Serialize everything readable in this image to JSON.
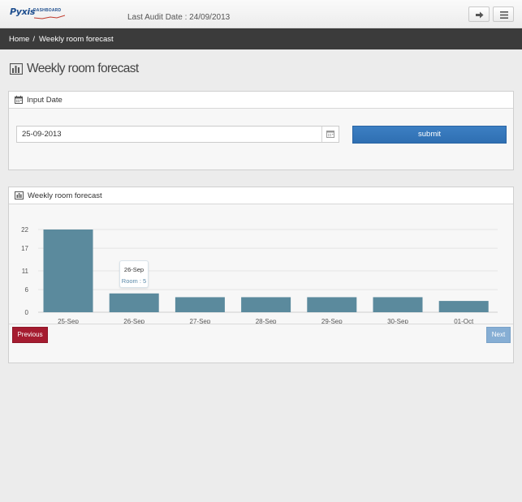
{
  "header": {
    "logo_text": "Pyxis",
    "logo_sub": "DASHBOARD",
    "audit_text": "Last Audit Date : 24/09/2013",
    "logout_icon": "sign-out-icon",
    "menu_icon": "bars-icon"
  },
  "breadcrumb": {
    "home": "Home",
    "separator": "/",
    "current": "Weekly room forecast"
  },
  "page": {
    "title": "Weekly room forecast",
    "title_icon": "bar-chart-icon"
  },
  "input_panel": {
    "title": "Input Date",
    "title_icon": "calendar-icon",
    "date_value": "25-09-2013",
    "submit_label": "submit"
  },
  "chart_panel": {
    "title": "Weekly room forecast",
    "title_icon": "bar-chart-icon",
    "previous_label": "Previous",
    "next_label": "Next"
  },
  "tooltip": {
    "x_label": "26-Sep",
    "value_text": "Room : 5"
  },
  "colors": {
    "bar": "#5b8a9d",
    "submit": "#3377bb",
    "previous": "#a51c30",
    "next": "#86aed4",
    "breadcrumb_bg": "#3b3b3b"
  },
  "chart_data": {
    "type": "bar",
    "categories": [
      "25-Sep",
      "26-Sep",
      "27-Sep",
      "28-Sep",
      "29-Sep",
      "30-Sep",
      "01-Oct"
    ],
    "series": [
      {
        "values": [
          22,
          5,
          4,
          4,
          4,
          4,
          3
        ]
      }
    ],
    "yticks": [
      0,
      6,
      11,
      17,
      22
    ],
    "ylim": [
      0,
      22
    ],
    "grid": true,
    "legend": "none"
  }
}
